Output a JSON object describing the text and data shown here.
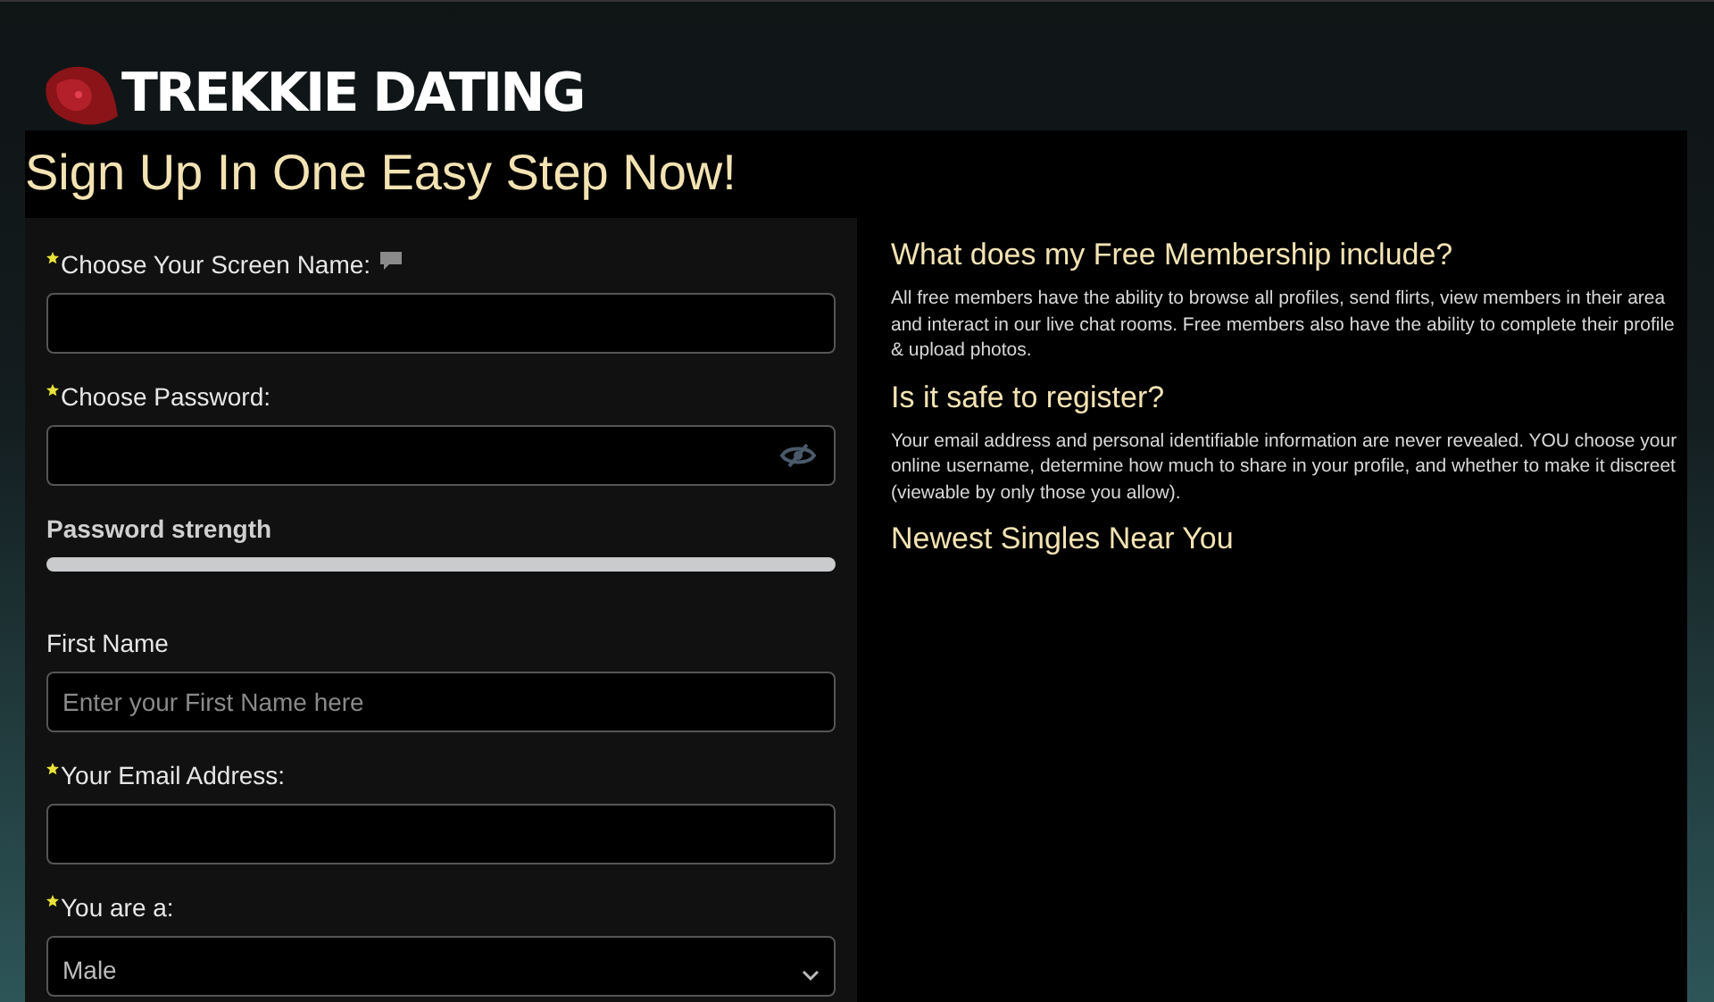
{
  "logo": {
    "text": "TREKKIE DATING"
  },
  "heading": "Sign Up In One Easy Step Now!",
  "fields": [
    {
      "kind": "text",
      "label": "Choose Your Screen Name:",
      "required": true,
      "has_tooltip": true
    },
    {
      "kind": "password",
      "label": "Choose Password:",
      "required": true,
      "has_tooltip": false
    },
    {
      "kind": "strength",
      "label": "Password strength"
    },
    {
      "kind": "text",
      "label": "First Name",
      "required": false,
      "has_tooltip": false,
      "placeholder": "Enter your First Name here"
    },
    {
      "kind": "text",
      "label": "Your Email Address:",
      "required": true,
      "has_tooltip": false
    },
    {
      "kind": "select",
      "label": "You are a:",
      "required": true,
      "has_tooltip": false,
      "value": "Male"
    }
  ],
  "info": [
    {
      "title": "What does my Free Membership include?",
      "body": "All free members have the ability to browse all profiles, send flirts, view members in their area and interact in our live chat rooms. Free members also have the ability to complete their profile & upload photos."
    },
    {
      "title": "Is it safe to register?",
      "body": "Your email address and personal identifiable information are never revealed. YOU choose your online username, determine how much to share in your profile, and whether to make it discreet (viewable by only those you allow)."
    },
    {
      "title": "Newest Singles Near You"
    }
  ]
}
